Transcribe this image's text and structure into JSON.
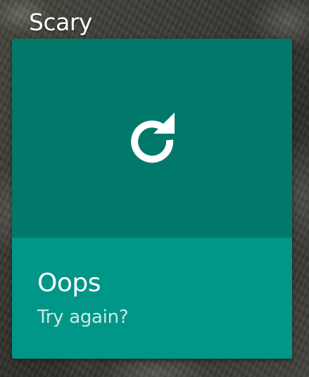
{
  "screen": {
    "title": "Scary"
  },
  "card": {
    "icon": "refresh-icon",
    "heading": "Oops",
    "subtext": "Try again?",
    "colors": {
      "top": "#00796b",
      "bottom": "#009688",
      "text": "#ffffff"
    }
  }
}
